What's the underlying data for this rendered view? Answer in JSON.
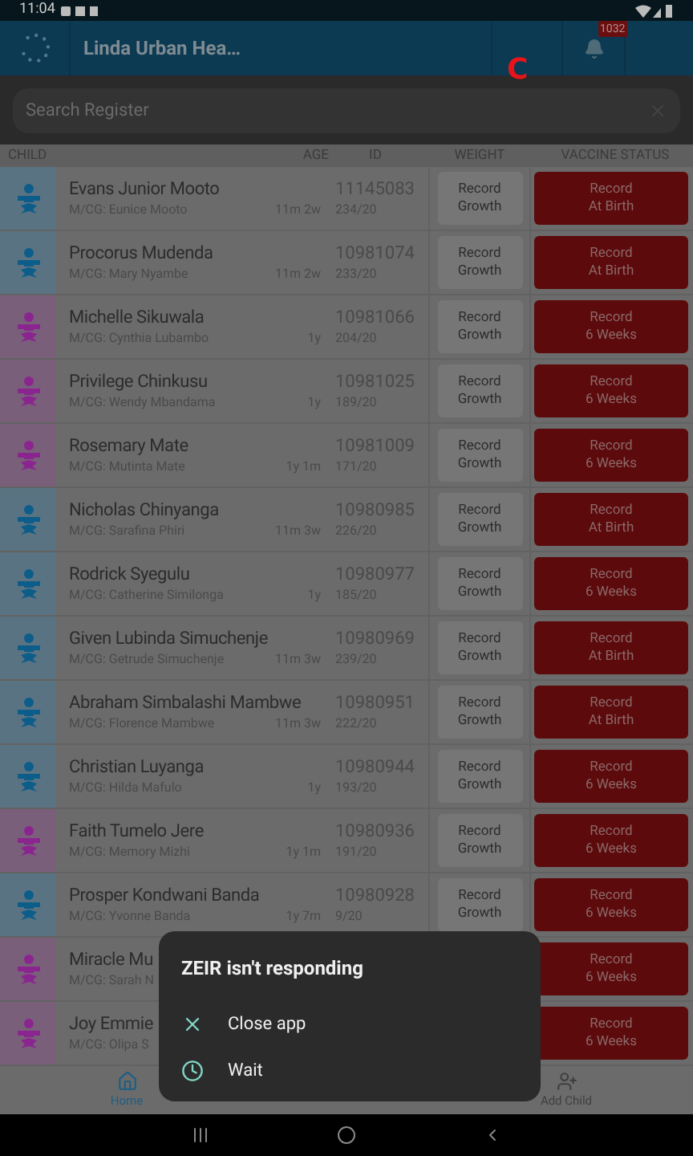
{
  "status_bar": {
    "time": "11:04"
  },
  "header": {
    "title": "Linda Urban Hea…",
    "notification_count": "1032",
    "marker": "C"
  },
  "search": {
    "placeholder": "Search Register"
  },
  "columns": [
    "CHILD",
    "AGE",
    "ID",
    "WEIGHT",
    "VACCINE STATUS"
  ],
  "rows": [
    {
      "kind": "boy",
      "name": "Evans Junior Mooto",
      "caregiver": "M/CG: Eunice Mooto",
      "age": "11m 2w",
      "id": "11145083",
      "number": "234/20",
      "weight_action": "Record Growth",
      "vaccine_action": "Record",
      "vaccine_due": "At Birth"
    },
    {
      "kind": "boy",
      "name": "Procorus Mudenda",
      "caregiver": "M/CG: Mary Nyambe",
      "age": "11m 2w",
      "id": "10981074",
      "number": "233/20",
      "weight_action": "Record Growth",
      "vaccine_action": "Record",
      "vaccine_due": "At Birth"
    },
    {
      "kind": "girl",
      "name": "Michelle Sikuwala",
      "caregiver": "M/CG: Cynthia Lubambo",
      "age": "1y",
      "id": "10981066",
      "number": "204/20",
      "weight_action": "Record Growth",
      "vaccine_action": "Record",
      "vaccine_due": "6 Weeks"
    },
    {
      "kind": "girl",
      "name": "Privilege Chinkusu",
      "caregiver": "M/CG: Wendy Mbandama",
      "age": "1y",
      "id": "10981025",
      "number": "189/20",
      "weight_action": "Record Growth",
      "vaccine_action": "Record",
      "vaccine_due": "6 Weeks"
    },
    {
      "kind": "girl",
      "name": "Rosemary Mate",
      "caregiver": "M/CG: Mutinta Mate",
      "age": "1y 1m",
      "id": "10981009",
      "number": "171/20",
      "weight_action": "Record Growth",
      "vaccine_action": "Record",
      "vaccine_due": "6 Weeks"
    },
    {
      "kind": "boy",
      "name": "Nicholas Chinyanga",
      "caregiver": "M/CG: Sarafina Phiri",
      "age": "11m 3w",
      "id": "10980985",
      "number": "226/20",
      "weight_action": "Record Growth",
      "vaccine_action": "Record",
      "vaccine_due": "At Birth"
    },
    {
      "kind": "boy",
      "name": "Rodrick Syegulu",
      "caregiver": "M/CG: Catherine Similonga",
      "age": "1y",
      "id": "10980977",
      "number": "185/20",
      "weight_action": "Record Growth",
      "vaccine_action": "Record",
      "vaccine_due": "6 Weeks"
    },
    {
      "kind": "boy",
      "name": "Given Lubinda Simuchenje",
      "caregiver": "M/CG: Getrude Simuchenje",
      "age": "11m 3w",
      "id": "10980969",
      "number": "239/20",
      "weight_action": "Record Growth",
      "vaccine_action": "Record",
      "vaccine_due": "At Birth"
    },
    {
      "kind": "boy",
      "name": "Abraham Simbalashi Mambwe",
      "caregiver": "M/CG: Florence Mambwe",
      "age": "11m 3w",
      "id": "10980951",
      "number": "222/20",
      "weight_action": "Record Growth",
      "vaccine_action": "Record",
      "vaccine_due": "At Birth"
    },
    {
      "kind": "boy",
      "name": "Christian Luyanga",
      "caregiver": "M/CG: Hilda Mafulo",
      "age": "1y",
      "id": "10980944",
      "number": "193/20",
      "weight_action": "Record Growth",
      "vaccine_action": "Record",
      "vaccine_due": "6 Weeks"
    },
    {
      "kind": "girl",
      "name": "Faith Tumelo Jere",
      "caregiver": "M/CG: Memory Mizhi",
      "age": "1y 1m",
      "id": "10980936",
      "number": "191/20",
      "weight_action": "Record Growth",
      "vaccine_action": "Record",
      "vaccine_due": "6 Weeks"
    },
    {
      "kind": "boy",
      "name": "Prosper Kondwani Banda",
      "caregiver": "M/CG: Yvonne Banda",
      "age": "1y 7m",
      "id": "10980928",
      "number": "9/20",
      "weight_action": "Record Growth",
      "vaccine_action": "Record",
      "vaccine_due": "6 Weeks"
    },
    {
      "kind": "girl",
      "name": "Miracle Mu",
      "caregiver": "M/CG: Sarah N",
      "vaccine_action": "Record",
      "vaccine_due": "6 Weeks"
    },
    {
      "kind": "girl",
      "name": "Joy Emmie",
      "caregiver": "M/CG: Olipa S",
      "vaccine_action": "Record",
      "vaccine_due": "6 Weeks"
    }
  ],
  "bottom_nav": [
    {
      "kind": "home",
      "label": "Home",
      "selected": true
    },
    {
      "kind": "add",
      "label": "Add Child",
      "selected": false
    }
  ],
  "dialog": {
    "title": "ZEIR isn't responding",
    "options": [
      {
        "kind": "close",
        "label": "Close app"
      },
      {
        "kind": "wait",
        "label": "Wait"
      }
    ]
  }
}
